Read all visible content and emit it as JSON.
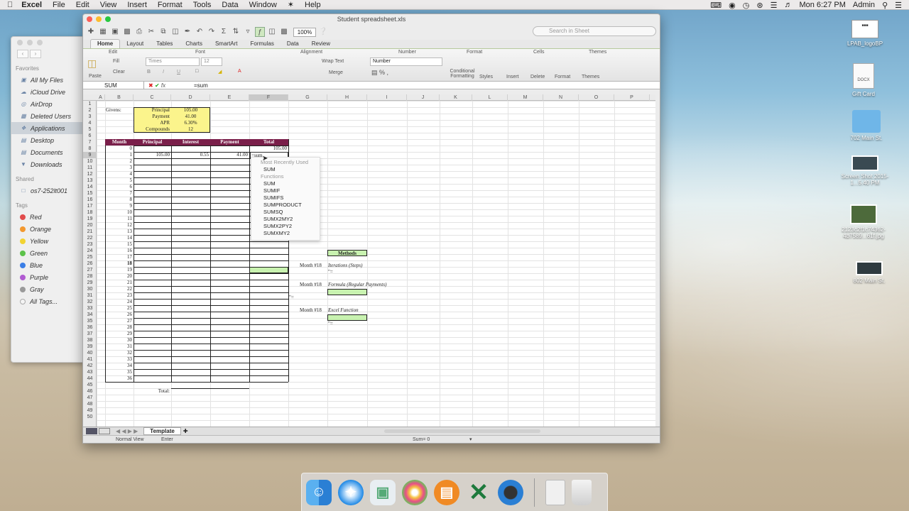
{
  "menubar": {
    "app": "Excel",
    "items": [
      "File",
      "Edit",
      "View",
      "Insert",
      "Format",
      "Tools",
      "Data",
      "Window",
      "Help"
    ],
    "clock": "Mon 6:27 PM",
    "user": "Admin"
  },
  "finder": {
    "favorites_title": "Favorites",
    "favorites": [
      "All My Files",
      "iCloud Drive",
      "AirDrop",
      "Deleted Users",
      "Applications",
      "Desktop",
      "Documents",
      "Downloads"
    ],
    "shared_title": "Shared",
    "shared": [
      "os7-252lt001"
    ],
    "tags_title": "Tags",
    "tags": [
      {
        "label": "Red",
        "color": "#e14b4b"
      },
      {
        "label": "Orange",
        "color": "#f3982f"
      },
      {
        "label": "Yellow",
        "color": "#f2d332"
      },
      {
        "label": "Green",
        "color": "#5cc24a"
      },
      {
        "label": "Blue",
        "color": "#3b7ee6"
      },
      {
        "label": "Purple",
        "color": "#b05bd1"
      },
      {
        "label": "Gray",
        "color": "#9a9a9a"
      },
      {
        "label": "All Tags...",
        "color": ""
      }
    ]
  },
  "window": {
    "title": "Student spreadsheet.xls"
  },
  "toolbar": {
    "zoom": "100%",
    "search_placeholder": "Search in Sheet"
  },
  "ribbon": {
    "tabs": [
      "Home",
      "Layout",
      "Tables",
      "Charts",
      "SmartArt",
      "Formulas",
      "Data",
      "Review"
    ],
    "groups": [
      "Edit",
      "Font",
      "Alignment",
      "Number",
      "Format",
      "Cells",
      "Themes"
    ],
    "paste": "Paste",
    "fill": "Fill",
    "clear": "Clear",
    "font_name": "Times",
    "font_size": "12",
    "wrap_text": "Wrap Text",
    "merge": "Merge",
    "number_format": "Number",
    "conditional": "Conditional Formatting",
    "styles": "Styles",
    "insert": "Insert",
    "delete": "Delete",
    "format": "Format",
    "themes": "Themes"
  },
  "formula_bar": {
    "name_box": "SUM",
    "fx": "fx",
    "value": "=sum"
  },
  "columns": [
    "A",
    "B",
    "C",
    "D",
    "E",
    "F",
    "G",
    "H",
    "I",
    "J",
    "K",
    "L",
    "M",
    "N",
    "O",
    "P"
  ],
  "sheet": {
    "givens_label": "Givens:",
    "givens": [
      {
        "label": "Principal",
        "value": "105.00"
      },
      {
        "label": "Payment",
        "value": "41.00"
      },
      {
        "label": "APR",
        "value": "6.30%"
      },
      {
        "label": "Compounds",
        "value": "12"
      }
    ],
    "table_headers": [
      "Month",
      "Principal",
      "Interest",
      "Payment",
      "Total"
    ],
    "row8_total": "105.00",
    "row9": {
      "principal": "105.00",
      "interest": "0.55",
      "payment": "41.00",
      "typing": "=sum"
    },
    "total_label": "Total:",
    "methods_label": "Methods",
    "method1_month": "Month #18",
    "method1_name": "Iterations (Steps)",
    "method2_month": "Month #18",
    "method2_name": "Formula (Regular Payments)",
    "method3_month": "Month #18",
    "method3_name": "Excel Function",
    "eq": "=",
    "eq_quote": "\"="
  },
  "autocomplete": {
    "recent_title": "Most Recently Used",
    "recent": [
      "SUM"
    ],
    "functions_title": "Functions",
    "functions": [
      "SUM",
      "SUMIF",
      "SUMIFS",
      "SUMPRODUCT",
      "SUMSQ",
      "SUMX2MY2",
      "SUMX2PY2",
      "SUMXMY2"
    ]
  },
  "sheet_tabs": {
    "active": "Template"
  },
  "status": {
    "view": "Normal View",
    "mode": "Enter",
    "sum": "Sum= 0"
  },
  "desktop": {
    "icons": [
      "LPAB_logoBP",
      "Gift Card",
      "702 Main St.",
      "Screen Shot 2015-1...5.40 PM",
      "2123c2f1c74362-4b7589...61f.jpg",
      "802 Main St."
    ],
    "docx_label": "DOCX"
  }
}
